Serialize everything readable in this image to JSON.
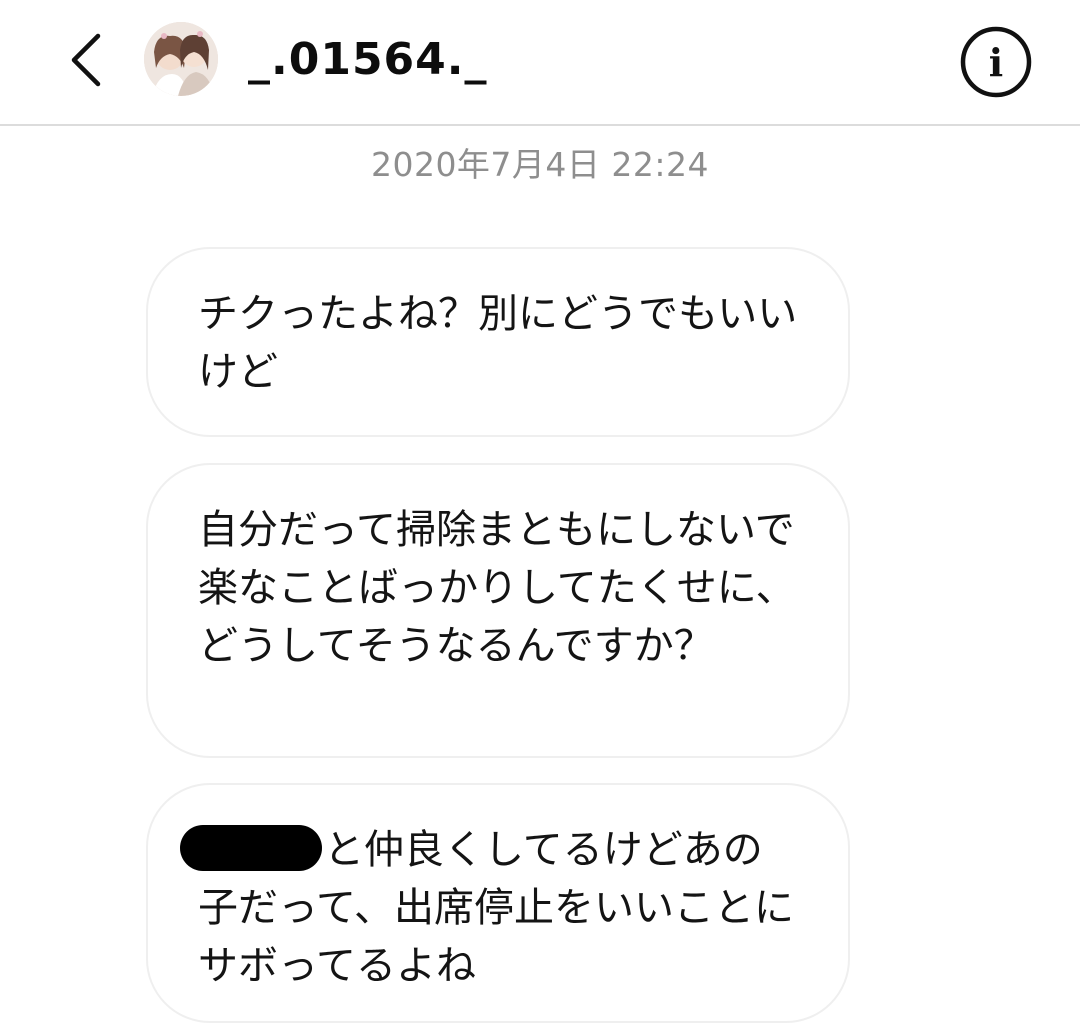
{
  "header": {
    "back_icon": "chevron-left-icon",
    "username": "_.01564._",
    "info_icon": "info-circle-icon",
    "info_glyph": "i"
  },
  "conversation": {
    "timestamp": "2020年7月4日 22:24",
    "messages": [
      {
        "text": "チクったよね？別にどうでもいいけど"
      },
      {
        "text": "自分だって掃除まともにしないで楽なことばっかりしてたくせに、どうしてそうなるんですか？"
      },
      {
        "redacted_prefix": true,
        "text": "と仲良くしてるけどあの子だって、出席停止をいいことにサボってるよね"
      }
    ]
  },
  "colors": {
    "divider": "#dcdcdc",
    "bubble_border": "#efefef",
    "timestamp": "#8e8e8e",
    "redaction": "#000000"
  }
}
